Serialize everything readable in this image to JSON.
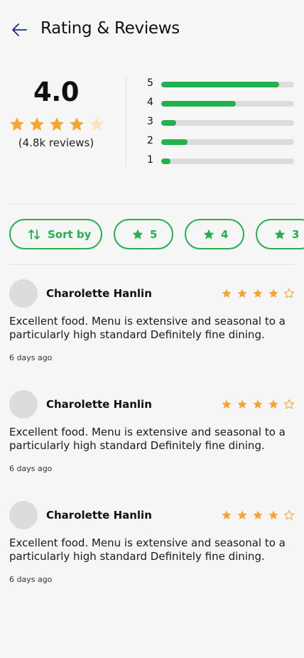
{
  "header": {
    "title": "Rating & Reviews",
    "back_icon": "arrow-left-icon"
  },
  "summary": {
    "average": "4.0",
    "average_stars": 4,
    "review_count_label": "(4.8k reviews)",
    "breakdown": [
      {
        "label": "5",
        "fraction": 0.89
      },
      {
        "label": "4",
        "fraction": 0.56
      },
      {
        "label": "3",
        "fraction": 0.11
      },
      {
        "label": "2",
        "fraction": 0.2
      },
      {
        "label": "1",
        "fraction": 0.07
      }
    ]
  },
  "filters": {
    "sort_label": "Sort by",
    "chips": [
      {
        "label": "5"
      },
      {
        "label": "4"
      },
      {
        "label": "3"
      }
    ]
  },
  "reviews": [
    {
      "name": "Charolette Hanlin",
      "rating": 4,
      "text": "Excellent food. Menu is extensive and seasonal to a particularly high standard Definitely fine dining.",
      "time": "6 days ago"
    },
    {
      "name": "Charolette Hanlin",
      "rating": 4,
      "text": "Excellent food. Menu is extensive and seasonal to a particularly high standard Definitely fine dining.",
      "time": "6 days ago"
    },
    {
      "name": "Charolette Hanlin",
      "rating": 4,
      "text": "Excellent food. Menu is extensive and seasonal to a particularly high standard Definitely fine dining.",
      "time": "6 days ago"
    }
  ],
  "colors": {
    "accent": "#23b14d",
    "star": "#f6a531",
    "star_faint": "#fce3c0",
    "track": "#dcdcdc"
  }
}
